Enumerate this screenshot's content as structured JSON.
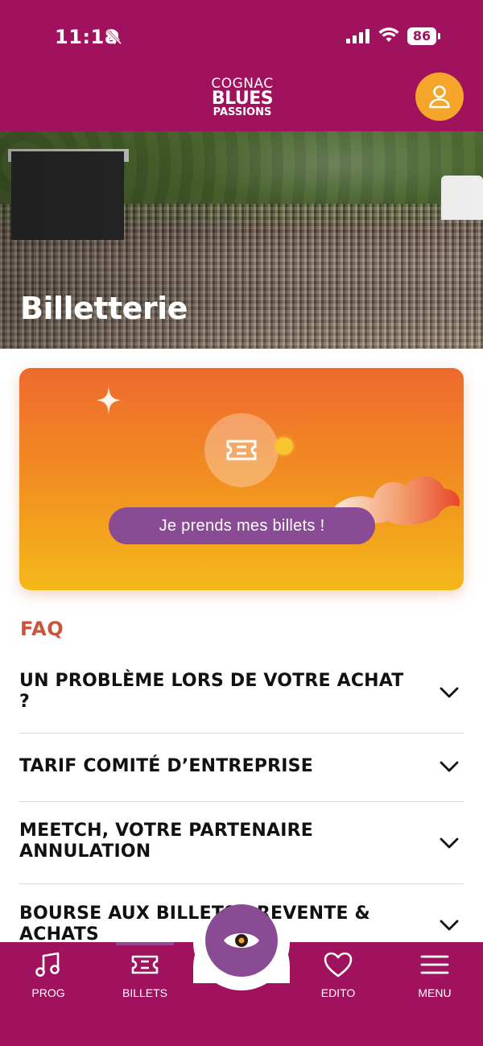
{
  "status_bar": {
    "time": "11:18",
    "battery": "86"
  },
  "header": {
    "logo_line1": "COGNAC",
    "logo_line2": "BLUES",
    "logo_line3": "PASSIONS"
  },
  "hero": {
    "title": "Billetterie"
  },
  "ticket_card": {
    "cta_label": "Je prends mes billets !"
  },
  "faq": {
    "title": "FAQ",
    "items": [
      {
        "question": "UN PROBLÈME LORS DE VOTRE ACHAT ?"
      },
      {
        "question": "TARIF COMITÉ D’ENTREPRISE"
      },
      {
        "question": "MEETCH, VOTRE PARTENAIRE ANNULATION"
      },
      {
        "question": "BOURSE AUX BILLETS : REVENTE & ACHATS"
      }
    ]
  },
  "bottom_nav": {
    "items": [
      {
        "label": "PROG",
        "icon": "music-note-icon"
      },
      {
        "label": "BILLETS",
        "icon": "ticket-icon"
      },
      {
        "label": "EDITO",
        "icon": "heart-icon"
      },
      {
        "label": "MENU",
        "icon": "hamburger-menu-icon"
      }
    ],
    "center_icon": "eye-icon",
    "active_item": "BILLETS"
  },
  "colors": {
    "brand": "#a0125e",
    "accent": "#f4a52a",
    "purple": "#8a4b95",
    "faq_title": "#c9543e"
  }
}
